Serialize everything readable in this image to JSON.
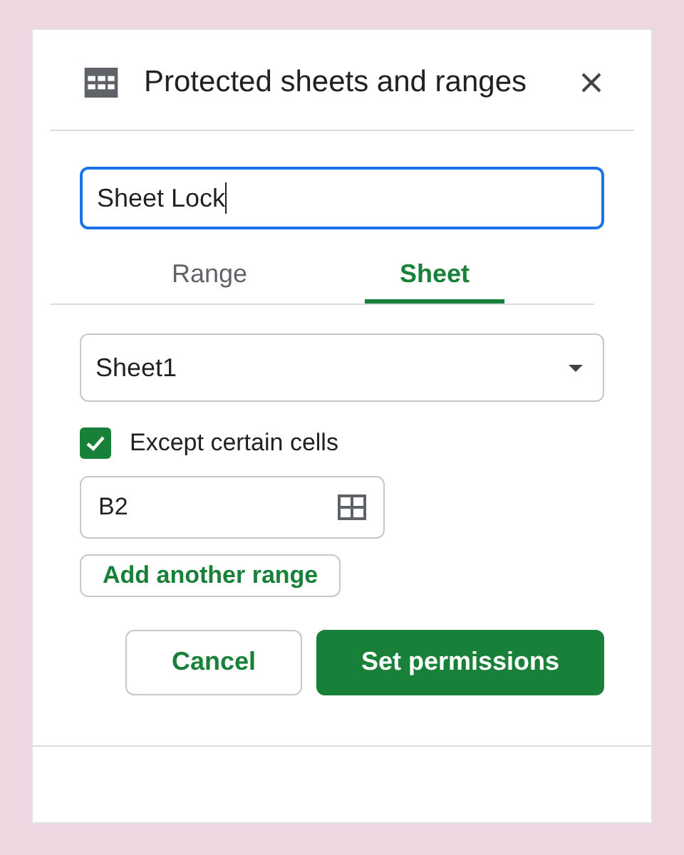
{
  "panel": {
    "title": "Protected sheets and ranges"
  },
  "description_field": {
    "value": "Sheet Lock",
    "focused": true
  },
  "tabs": [
    {
      "label": "Range",
      "selected": false
    },
    {
      "label": "Sheet",
      "selected": true
    }
  ],
  "sheet_select": {
    "value": "Sheet1"
  },
  "except_cells": {
    "label": "Except certain cells",
    "checked": true
  },
  "range_field": {
    "value": "B2"
  },
  "add_range_button": "Add another range",
  "buttons": [
    {
      "label": "Cancel",
      "kind": "secondary"
    },
    {
      "label": "Set permissions",
      "kind": "primary"
    }
  ]
}
